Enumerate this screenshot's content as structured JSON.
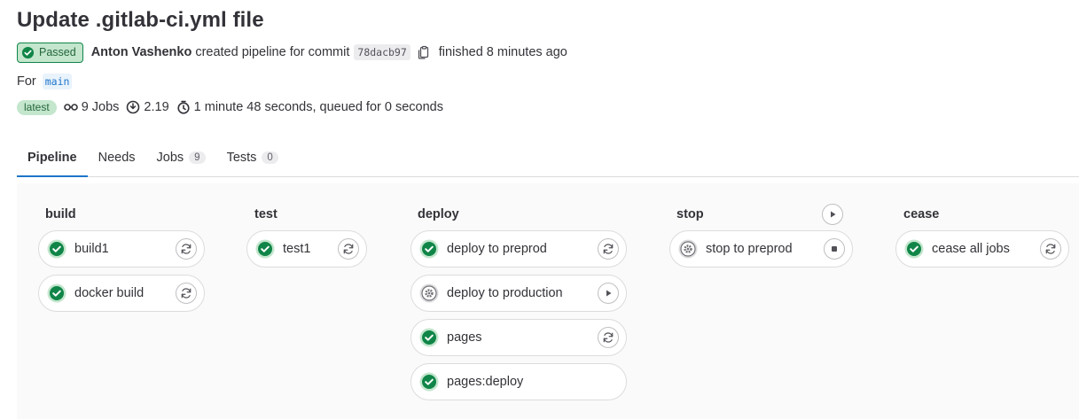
{
  "page": {
    "title": "Update .gitlab-ci.yml file"
  },
  "header": {
    "status_label": "Passed",
    "author": "Anton Vashenko",
    "action_text": "created pipeline for commit",
    "commit_sha": "78dacb97",
    "finished_text": "finished 8 minutes ago",
    "for_label": "For",
    "ref": "main",
    "latest_label": "latest",
    "jobs_count_text": "9 Jobs",
    "compute_text": "2.19",
    "duration_text": "1 minute 48 seconds, queued for 0 seconds"
  },
  "tabs": [
    {
      "label": "Pipeline",
      "count": ""
    },
    {
      "label": "Needs",
      "count": ""
    },
    {
      "label": "Jobs",
      "count": "9"
    },
    {
      "label": "Tests",
      "count": "0"
    }
  ],
  "stages": [
    {
      "name": "build",
      "jobs": [
        {
          "name": "build1",
          "status": "success",
          "action": "retry-icon"
        },
        {
          "name": "docker build",
          "status": "success",
          "action": "retry-icon"
        }
      ]
    },
    {
      "name": "test",
      "jobs": [
        {
          "name": "test1",
          "status": "success",
          "action": "retry-icon"
        }
      ]
    },
    {
      "name": "deploy",
      "jobs": [
        {
          "name": "deploy to preprod",
          "status": "success",
          "action": "retry-icon"
        },
        {
          "name": "deploy to production",
          "status": "manual",
          "action": "play-icon"
        },
        {
          "name": "pages",
          "status": "success",
          "action": "retry-icon"
        },
        {
          "name": "pages:deploy",
          "status": "success",
          "action": ""
        }
      ]
    },
    {
      "name": "stop",
      "stage_action": "play-icon",
      "jobs": [
        {
          "name": "stop to preprod",
          "status": "manual",
          "action": "stop-icon"
        }
      ]
    },
    {
      "name": "cease",
      "jobs": [
        {
          "name": "cease all jobs",
          "status": "success",
          "action": "retry-icon"
        }
      ]
    }
  ],
  "colors": {
    "success": "#108548",
    "success_bg": "#c3e6cd",
    "manual": "#737278",
    "accent": "#1f75cb"
  }
}
